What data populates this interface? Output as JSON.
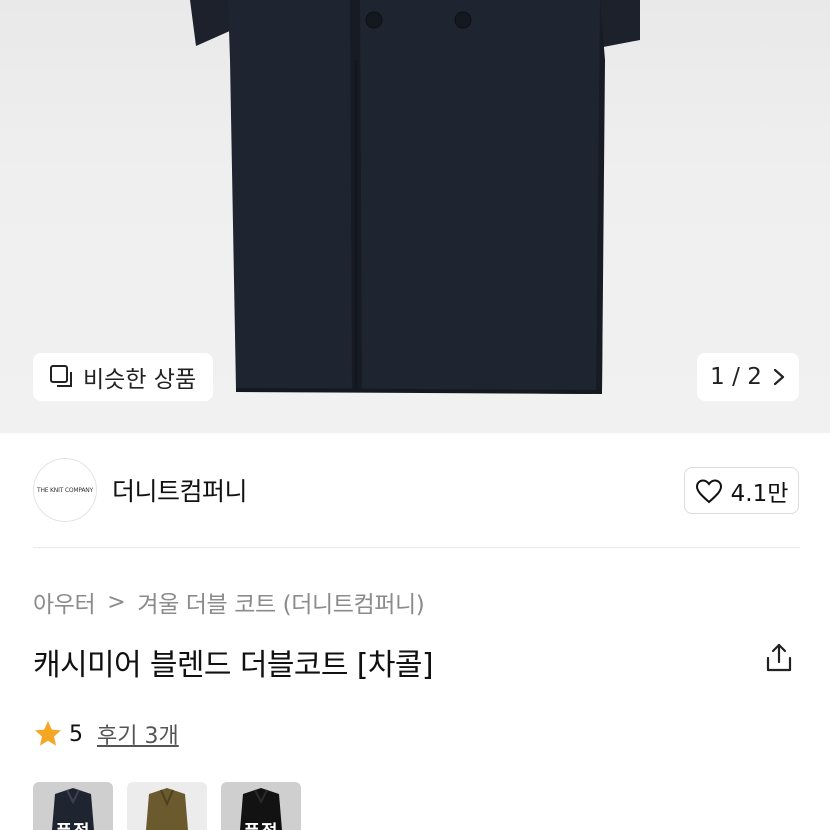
{
  "gallery": {
    "similar_label": "비슷한 상품",
    "similar_icon": "similar-items-icon",
    "pager_current": "1",
    "pager_separator": "/",
    "pager_total": "2",
    "pager_icon": "chevron-right-icon"
  },
  "brand": {
    "logo_text": "THE KNIT COMPANY",
    "name": "더니트컴퍼니",
    "like_count": "4.1만",
    "like_icon": "heart-outline-icon"
  },
  "breadcrumb": {
    "items": [
      "아우터",
      "겨울 더블 코트 (더니트컴퍼니)"
    ],
    "separator": ">"
  },
  "product": {
    "title": "캐시미어 블렌드 더블코트 [차콜]",
    "share_icon": "share-icon"
  },
  "rating": {
    "score": "5",
    "reviews_label": "후기 3개",
    "star_color": "#F5A623"
  },
  "variants": [
    {
      "badge": "품절",
      "color": "#1f2530"
    },
    {
      "badge": "",
      "color": "#6b5a2e"
    },
    {
      "badge": "품절",
      "color": "#121212"
    }
  ]
}
